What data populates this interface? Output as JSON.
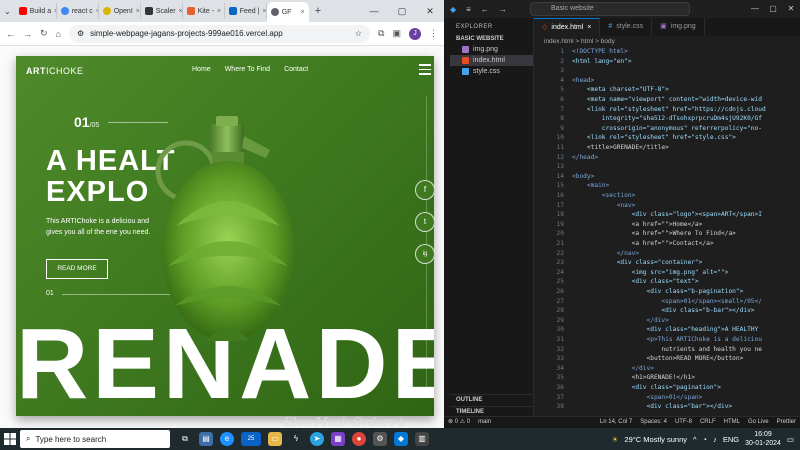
{
  "browser": {
    "tabs": [
      {
        "title": "Build a",
        "color": "#ff0000"
      },
      {
        "title": "react c",
        "color": "#4285f4"
      },
      {
        "title": "OpenI",
        "color": "#d9b400"
      },
      {
        "title": "Scaler",
        "color": "#333333"
      },
      {
        "title": "Kite -",
        "color": "#e8602c"
      },
      {
        "title": "Feed |",
        "color": "#0a66c2"
      },
      {
        "title": "GF",
        "color": "#5f6368"
      }
    ],
    "new_tab": "+",
    "url": "simple-webpage-jagans-projects-999ae016.vercel.app",
    "profile_initial": "J"
  },
  "site": {
    "logo_bold": "ART",
    "logo_rest": "ICHOKE",
    "nav": [
      "Home",
      "Where To Find",
      "Contact"
    ],
    "page_current": "01",
    "page_total": "/05",
    "heading_line1": "A HEALT",
    "heading_line2": "EXPLO",
    "description": "This ARTIChoke is a deliciou and gives you all of the ene you need.",
    "read_more": "READ MORE",
    "bottom_page": "01",
    "big_text": "RENADE",
    "social": [
      "f",
      "t",
      "ig"
    ]
  },
  "vscode": {
    "search": "Basic website",
    "explorer_header": "EXPLORER",
    "project": "BASIC WEBSITE",
    "files": [
      "img.png",
      "index.html",
      "style.css"
    ],
    "outline": "OUTLINE",
    "timeline": "TIMELINE",
    "tabs": [
      "index.html",
      "style.css",
      "img.png"
    ],
    "breadcrumbs": "index.html  >  html  >  body",
    "code_lines": [
      {
        "n": "1",
        "t": "<!DOCTYPE html>"
      },
      {
        "n": "2",
        "t": "<html lang=\"en\">"
      },
      {
        "n": "3",
        "t": ""
      },
      {
        "n": "4",
        "t": "<head>"
      },
      {
        "n": "5",
        "t": "    <meta charset=\"UTF-8\">"
      },
      {
        "n": "6",
        "t": "    <meta name=\"viewport\" content=\"width=device-wid"
      },
      {
        "n": "7",
        "t": "    <link rel=\"stylesheet\" href=\"https://cdnjs.cloud"
      },
      {
        "n": "8",
        "t": "        integrity=\"sha512-dTsohxprpcruDm4sjU92K0/Gf"
      },
      {
        "n": "9",
        "t": "        crossorigin=\"anonymous\" referrerpolicy=\"no-"
      },
      {
        "n": "10",
        "t": "    <link rel=\"stylesheet\" href=\"style.css\">"
      },
      {
        "n": "11",
        "t": "    <title>GRENADE</title>"
      },
      {
        "n": "12",
        "t": "</head>"
      },
      {
        "n": "13",
        "t": ""
      },
      {
        "n": "14",
        "t": "<body>"
      },
      {
        "n": "15",
        "t": "    <main>"
      },
      {
        "n": "16",
        "t": "        <section>"
      },
      {
        "n": "17",
        "t": "            <nav>"
      },
      {
        "n": "18",
        "t": "                <div class=\"logo\"><span>ART</span>I"
      },
      {
        "n": "19",
        "t": "                <a href=\"\">Home</a>"
      },
      {
        "n": "20",
        "t": "                <a href=\"\">Where To Find</a>"
      },
      {
        "n": "21",
        "t": "                <a href=\"\">Contact</a>"
      },
      {
        "n": "22",
        "t": "            </nav>"
      },
      {
        "n": "23",
        "t": "            <div class=\"container\">"
      },
      {
        "n": "24",
        "t": "                <img src=\"img.png\" alt=\"\">"
      },
      {
        "n": "25",
        "t": "                <div class=\"text\">"
      },
      {
        "n": "26",
        "t": "                    <div class=\"b-pagination\">"
      },
      {
        "n": "27",
        "t": "                        <span>01</span><small>/05</"
      },
      {
        "n": "28",
        "t": "                        <div class=\"b-bar\"></div>"
      },
      {
        "n": "29",
        "t": "                    </div>"
      },
      {
        "n": "30",
        "t": "                    <div class=\"heading\">A HEALTHY"
      },
      {
        "n": "31",
        "t": "                    <p>This ARTIChoke is a deliciou"
      },
      {
        "n": "32",
        "t": "                        nutrients and health you ne"
      },
      {
        "n": "33",
        "t": "                    <button>READ MORE</button>"
      },
      {
        "n": "34",
        "t": "                </div>"
      },
      {
        "n": "35",
        "t": "                <h1>GRENADE!</h1>"
      },
      {
        "n": "36",
        "t": "                <div class=\"pagination\">"
      },
      {
        "n": "37",
        "t": "                    <span>01</span>"
      },
      {
        "n": "38",
        "t": "                    <div class=\"bar\"></div>"
      }
    ],
    "status": {
      "branch": "main",
      "position": "Ln 14, Col 7",
      "spaces": "Spaces: 4",
      "encoding": "UTF-8",
      "eol": "CRLF",
      "language": "HTML",
      "golive": "Go Live",
      "prettier": "Prettier"
    }
  },
  "wallpaper_text": "Elon Musk Orders t",
  "taskbar": {
    "search_placeholder": "Type here to search",
    "badge": "25",
    "weather": "29°C  Mostly sunny",
    "lang": "ENG",
    "time": "16:09",
    "date": "30-01-2024"
  }
}
